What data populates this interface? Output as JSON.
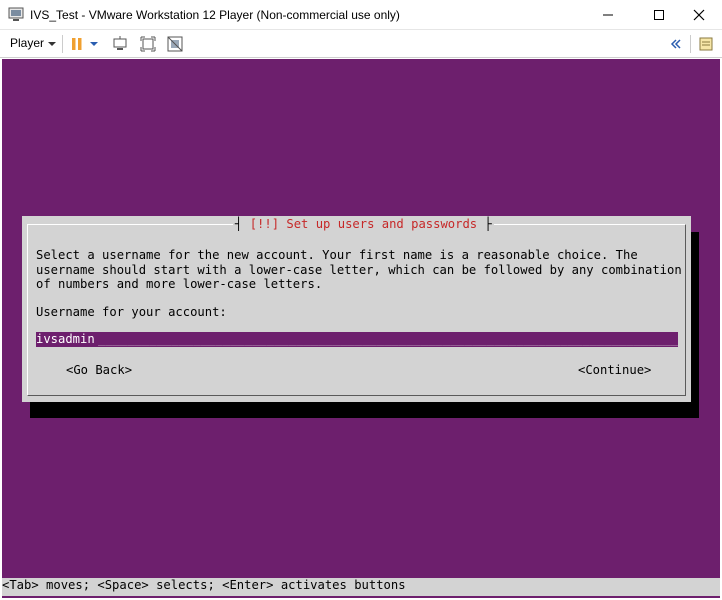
{
  "window": {
    "title": "IVS_Test - VMware Workstation 12 Player (Non-commercial use only)",
    "controls": {
      "minimize": "—",
      "maximize": "☐",
      "close": "✕"
    }
  },
  "toolbar": {
    "player_label": "Player",
    "icons": [
      "pause-icon",
      "dropdown-icon",
      "send-ctrl-alt-del-icon",
      "fit-guest-icon",
      "unity-icon",
      "collapse-icon",
      "notes-icon"
    ]
  },
  "installer": {
    "dialog_title": "[!!] Set up users and passwords",
    "description": "Select a username for the new account. Your first name is a reasonable choice. The\nusername should start with a lower-case letter, which can be followed by any combination\nof numbers and more lower-case letters.",
    "prompt": "Username for your account:",
    "username_value": "ivsadmin",
    "input_fill": "____________________________________________________________________________________",
    "go_back_label": "<Go Back>",
    "continue_label": "<Continue>",
    "help_line": "<Tab> moves; <Space> selects; <Enter> activates buttons"
  },
  "colors": {
    "vm_background": "#6d1f6d",
    "dialog_background": "#d3d3d3",
    "dialog_title": "#c62828",
    "toolbar_accent": "#f0a030"
  }
}
